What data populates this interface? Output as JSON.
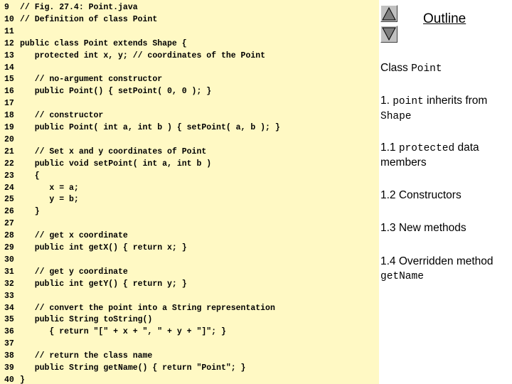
{
  "code": [
    {
      "ln": "9",
      "text": "// Fig. 27.4: Point.java"
    },
    {
      "ln": "10",
      "text": "// Definition of class Point"
    },
    {
      "ln": "11",
      "text": ""
    },
    {
      "ln": "12",
      "text": "public class Point extends Shape {"
    },
    {
      "ln": "13",
      "text": "   protected int x, y; // coordinates of the Point"
    },
    {
      "ln": "14",
      "text": ""
    },
    {
      "ln": "15",
      "text": "   // no-argument constructor"
    },
    {
      "ln": "16",
      "text": "   public Point() { setPoint( 0, 0 ); }"
    },
    {
      "ln": "17",
      "text": ""
    },
    {
      "ln": "18",
      "text": "   // constructor"
    },
    {
      "ln": "19",
      "text": "   public Point( int a, int b ) { setPoint( a, b ); }"
    },
    {
      "ln": "20",
      "text": ""
    },
    {
      "ln": "21",
      "text": "   // Set x and y coordinates of Point"
    },
    {
      "ln": "22",
      "text": "   public void setPoint( int a, int b )"
    },
    {
      "ln": "23",
      "text": "   {"
    },
    {
      "ln": "24",
      "text": "      x = a;"
    },
    {
      "ln": "25",
      "text": "      y = b;"
    },
    {
      "ln": "26",
      "text": "   }"
    },
    {
      "ln": "27",
      "text": ""
    },
    {
      "ln": "28",
      "text": "   // get x coordinate"
    },
    {
      "ln": "29",
      "text": "   public int getX() { return x; }"
    },
    {
      "ln": "30",
      "text": ""
    },
    {
      "ln": "31",
      "text": "   // get y coordinate"
    },
    {
      "ln": "32",
      "text": "   public int getY() { return y; }"
    },
    {
      "ln": "33",
      "text": ""
    },
    {
      "ln": "34",
      "text": "   // convert the point into a String representation"
    },
    {
      "ln": "35",
      "text": "   public String toString()"
    },
    {
      "ln": "36",
      "text": "      { return \"[\" + x + \", \" + y + \"]\"; }"
    },
    {
      "ln": "37",
      "text": ""
    },
    {
      "ln": "38",
      "text": "   // return the class name"
    },
    {
      "ln": "39",
      "text": "   public String getName() { return \"Point\"; }"
    },
    {
      "ln": "40",
      "text": "}"
    }
  ],
  "outline": {
    "title": "Outline",
    "class_label": "Class ",
    "class_name": "Point",
    "item1_num": "1. ",
    "item1_code": "point",
    "item1_text": " inherits from ",
    "item1_base": "Shape",
    "item2_num": "1.1 ",
    "item2_code": "protected",
    "item2_text": " data members",
    "item3": "1.2 Constructors",
    "item4": "1.3 New methods",
    "item5": "1.4 Overridden method",
    "item5_code": "getName"
  },
  "nav": {
    "up_icon": "triangle-up-icon",
    "down_icon": "triangle-down-icon"
  },
  "colors": {
    "code_background": "#fff9c4",
    "button_face": "#c0c0c0"
  }
}
